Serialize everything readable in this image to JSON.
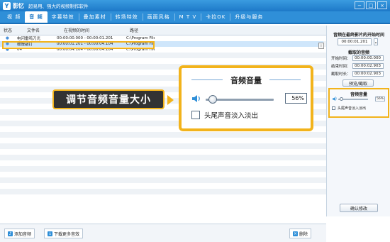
{
  "app": {
    "name": "影忆",
    "slogan": "超易用、强大的视频制作软件",
    "logo_letter": "Y"
  },
  "window_controls": [
    "−",
    "□",
    "×"
  ],
  "tabs": [
    {
      "label": "视 频",
      "active": false
    },
    {
      "label": "音 频",
      "active": true
    },
    {
      "label": "字幕特效",
      "active": false
    },
    {
      "label": "叠加素材",
      "active": false
    },
    {
      "label": "转场特效",
      "active": false
    },
    {
      "label": "画面风格",
      "active": false
    },
    {
      "label": "M T V",
      "active": false
    },
    {
      "label": "卡拉OK",
      "active": false
    },
    {
      "label": "升级与服务",
      "active": false
    }
  ],
  "table": {
    "headers": [
      "状态",
      "文件名",
      "在视频的时间",
      "路径"
    ],
    "rows": [
      {
        "status": "●",
        "name": "电闪雷鸣刀光",
        "time": "00:00:00.000 - 00:00:01.201",
        "path": "C:\\Program File...",
        "selected": false
      },
      {
        "status": "●",
        "name": "缓慢敲打",
        "time": "00:00:01.201 - 00:00:04.104",
        "path": "C:\\Program File...",
        "selected": true
      },
      {
        "status": "●",
        "name": "04",
        "time": "00:00:04.104 - 00:00:04.104",
        "path": "C:\\Program File...",
        "selected": false
      }
    ]
  },
  "bottom": {
    "add_audio": "添加音频",
    "download_more": "下载更多音效",
    "delete": "删除"
  },
  "sidebar": {
    "start_label": "音频在最终影片的开始时间",
    "start_value": "00:00:01.201",
    "clip_title": "截取的音频",
    "begin_label": "开始时间：",
    "begin_value": "00:00:00.000",
    "end_label": "结束时间：",
    "end_value": "00:00:02.903",
    "duration_label": "截取时长：",
    "duration_value": "00:00:02.903",
    "play_button": "预览/截取",
    "volume_title": "音频音量",
    "volume_value": "56%",
    "fade_label": "头尾声音淡入淡出",
    "confirm_button": "确认修改"
  },
  "callout": {
    "text": "调节音频音量大小"
  },
  "zoom": {
    "title": "音频音量",
    "volume_value": "56%",
    "volume_level": 0.56,
    "fade_label": "头尾声音淡入淡出"
  },
  "colors": {
    "accent": "#2f8fd8",
    "highlight": "#f2b31b",
    "callout_bg": "#333333"
  }
}
